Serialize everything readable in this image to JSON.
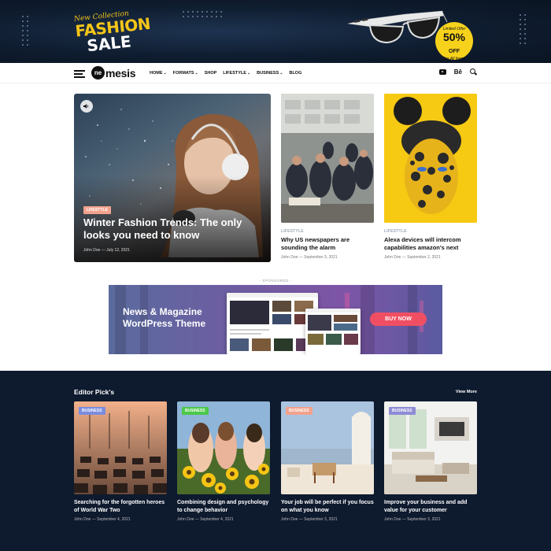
{
  "banner": {
    "script": "New Collection",
    "title_line1": "FASHION",
    "title_line2": "SALE",
    "tag_top": "Limited Offer",
    "tag_percent": "50%",
    "tag_off": "OFF",
    "tag_foot": "For All Items"
  },
  "nav": {
    "logo_mark": "ne",
    "logo_text": "mesis",
    "items": [
      {
        "label": "HOME",
        "dropdown": true
      },
      {
        "label": "FORMATS",
        "dropdown": true
      },
      {
        "label": "SHOP",
        "dropdown": false
      },
      {
        "label": "LIFESTYLE",
        "dropdown": true
      },
      {
        "label": "BUSINESS",
        "dropdown": true
      },
      {
        "label": "BLOG",
        "dropdown": false
      }
    ],
    "caret": "⌄",
    "social_behance": "Bē"
  },
  "hero": {
    "category": "LIFESTYLE",
    "title": "Winter Fashion Trends: The only looks you need to know",
    "meta": "John Doe   —   July 12, 2021"
  },
  "featured": [
    {
      "category": "LIFESTYLE",
      "title": "Why US newspapers are sounding the alarm",
      "meta": "John Doe   —   September 3, 2021"
    },
    {
      "category": "LIFESTYLE",
      "title": "Alexa devices will intercom capabilities amazon's next",
      "meta": "John Doe   —   September 2, 2021"
    }
  ],
  "ad": {
    "sponsored": "- SPONSORED -",
    "line1": "News & Magazine",
    "line2": "WordPress Theme",
    "button": "BUY NOW"
  },
  "picks": {
    "heading": "Editor Pick's",
    "view_more": "View More",
    "items": [
      {
        "badge": "BUSINESS",
        "badge_color": "#7b8cde",
        "title": "Searching for the forgotten heroes of World War Two",
        "meta": "John Doe   —   September 4, 2021"
      },
      {
        "badge": "BUSINESS",
        "badge_color": "#4cc84a",
        "title": "Combining design and psychology to change behavior",
        "meta": "John Doe   —   September 4, 2021"
      },
      {
        "badge": "BUSINESS",
        "badge_color": "#f2a28d",
        "title": "Your job will be perfect if you focus on what you know",
        "meta": "John Doe   —   September 3, 2021"
      },
      {
        "badge": "BUSINESS",
        "badge_color": "#8f8cd6",
        "title": "Improve your business and add value for your customer",
        "meta": "John Doe   —   September 3, 2021"
      }
    ]
  }
}
